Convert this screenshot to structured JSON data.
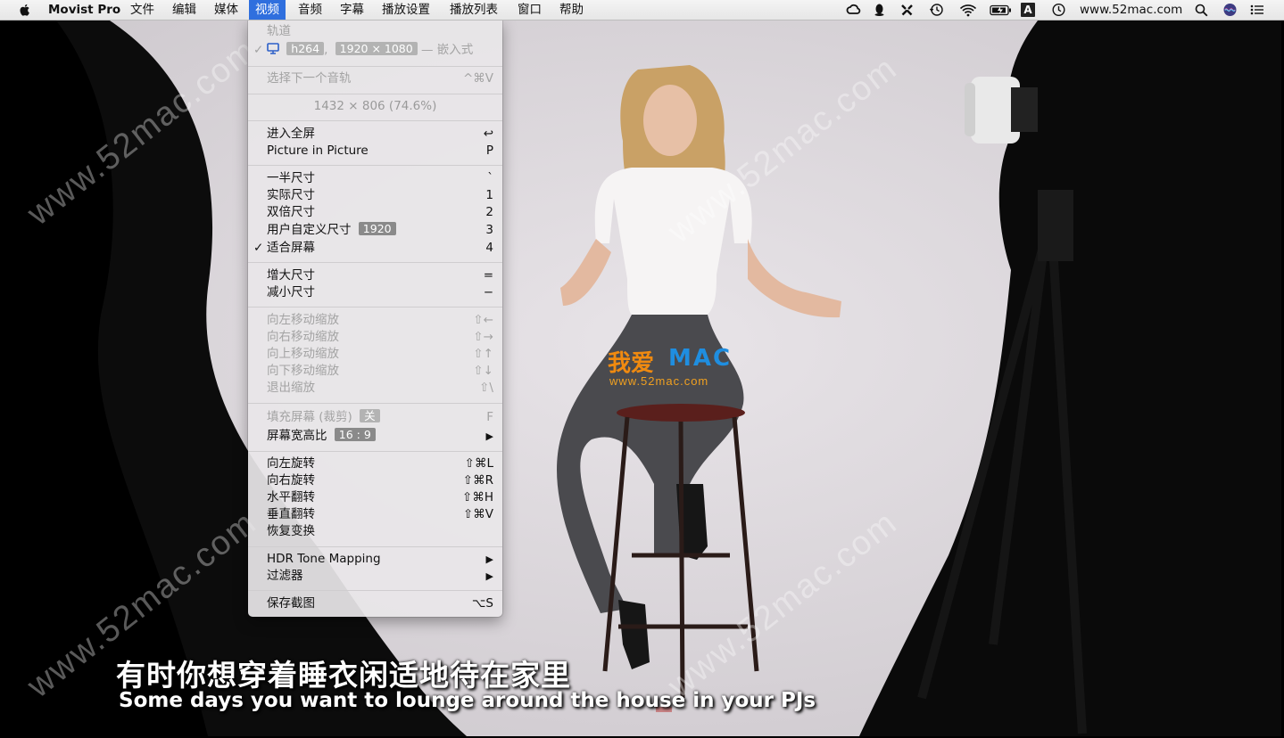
{
  "menubar": {
    "app_name": "Movist Pro",
    "items": [
      "文件",
      "编辑",
      "媒体",
      "视频",
      "音频",
      "字幕",
      "播放设置",
      "播放列表",
      "窗口",
      "帮助"
    ],
    "active_item": "视频",
    "status_url": "www.52mac.com",
    "input_method": "A"
  },
  "menu": {
    "track_header": "轨道",
    "track_codec": "h264",
    "track_resolution": "1920 × 1080",
    "track_suffix": "— 嵌入式",
    "next_audio_label": "选择下一个音轨",
    "next_audio_shortcut": "^⌘V",
    "window_size_info": "1432 × 806 (74.6%)",
    "fullscreen_label": "进入全屏",
    "fullscreen_shortcut": "↩",
    "pip_label": "Picture in Picture",
    "pip_shortcut": "P",
    "half_size_label": "一半尺寸",
    "half_size_shortcut": "`",
    "actual_size_label": "实际尺寸",
    "actual_size_shortcut": "1",
    "double_size_label": "双倍尺寸",
    "double_size_shortcut": "2",
    "custom_size_label": "用户自定义尺寸",
    "custom_size_value": "1920",
    "custom_size_shortcut": "3",
    "fit_screen_label": "适合屏幕",
    "fit_screen_shortcut": "4",
    "increase_size_label": "增大尺寸",
    "increase_size_shortcut": "=",
    "decrease_size_label": "减小尺寸",
    "decrease_size_shortcut": "−",
    "zoom_left_label": "向左移动缩放",
    "zoom_left_shortcut": "⇧←",
    "zoom_right_label": "向右移动缩放",
    "zoom_right_shortcut": "⇧→",
    "zoom_up_label": "向上移动缩放",
    "zoom_up_shortcut": "⇧↑",
    "zoom_down_label": "向下移动缩放",
    "zoom_down_shortcut": "⇧↓",
    "zoom_exit_label": "退出缩放",
    "zoom_exit_shortcut": "⇧\\",
    "fill_screen_label": "填充屏幕 (裁剪)",
    "fill_screen_value": "关",
    "fill_screen_shortcut": "F",
    "aspect_ratio_label": "屏幕宽高比",
    "aspect_ratio_value": "16 : 9",
    "rotate_left_label": "向左旋转",
    "rotate_left_shortcut": "⇧⌘L",
    "rotate_right_label": "向右旋转",
    "rotate_right_shortcut": "⇧⌘R",
    "flip_h_label": "水平翻转",
    "flip_h_shortcut": "⇧⌘H",
    "flip_v_label": "垂直翻转",
    "flip_v_shortcut": "⇧⌘V",
    "reset_transform_label": "恢复变换",
    "hdr_label": "HDR Tone Mapping",
    "filter_label": "过滤器",
    "save_screenshot_label": "保存截图",
    "save_screenshot_shortcut": "⌥S",
    "submenu_arrow": "▶",
    "check_mark": "✓"
  },
  "video": {
    "subtitle_cn": "有时你想穿着睡衣闲适地待在家里",
    "subtitle_en": "Some days you want to lounge around the house in your PJs",
    "watermark": "www.52mac.com",
    "logo_cn": "我爱",
    "logo_mac": "MAC",
    "logo_url": "www.52mac.com"
  },
  "colors": {
    "menu_highlight": "#2f6fde",
    "logo_orange": "#f08a10",
    "logo_blue": "#1f8ee0"
  },
  "icons": [
    "apple-icon",
    "creative-cloud-icon",
    "qq-icon",
    "tool-icon",
    "time-machine-icon",
    "wifi-icon",
    "battery-icon",
    "clock-icon",
    "search-icon",
    "siri-icon",
    "notification-center-icon",
    "display-icon"
  ]
}
